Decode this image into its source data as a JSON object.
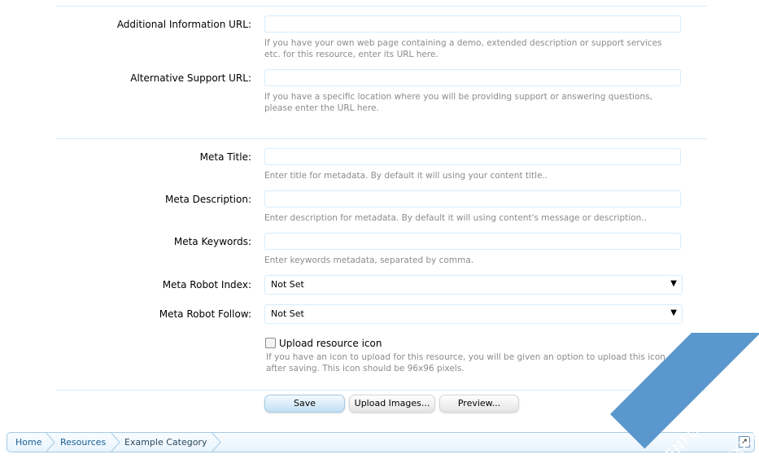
{
  "fields": {
    "additional_info_url": {
      "label": "Additional Information URL:",
      "value": "",
      "help": "If you have your own web page containing a demo, extended description or support services etc. for this resource, enter its URL here."
    },
    "alternative_support_url": {
      "label": "Alternative Support URL:",
      "value": "",
      "help": "If you have a specific location where you will be providing support or answering questions, please enter the URL here."
    },
    "meta_title": {
      "label": "Meta Title:",
      "value": "",
      "help": "Enter title for metadata. By default it will using your content title.."
    },
    "meta_description": {
      "label": "Meta Description:",
      "value": "",
      "help": "Enter description for metadata. By default it will using content's message or description.."
    },
    "meta_keywords": {
      "label": "Meta Keywords:",
      "value": "",
      "help": "Enter keywords metadata, separated by comma."
    },
    "meta_robot_index": {
      "label": "Meta Robot Index:",
      "selected": "Not Set"
    },
    "meta_robot_follow": {
      "label": "Meta Robot Follow:",
      "selected": "Not Set"
    },
    "upload_icon": {
      "label": "Upload resource icon",
      "checked": false,
      "help": "If you have an icon to upload for this resource, you will be given an option to upload this icon after saving. This icon should be 96x96 pixels."
    }
  },
  "buttons": {
    "save": "Save",
    "upload_images": "Upload Images...",
    "preview": "Preview..."
  },
  "breadcrumb": [
    "Home",
    "Resources",
    "Example Category"
  ],
  "watermark": {
    "line1": "XENFORO VIỆT NAM",
    "line2": "VXF.VN"
  },
  "colors": {
    "divider": "#d7edfc",
    "input_border": "#d7edfc",
    "help_text": "#8c8c8c",
    "primary_button": "#c2dff4",
    "breadcrumb_border": "#a5cae4",
    "watermark": "#5a97cc"
  }
}
